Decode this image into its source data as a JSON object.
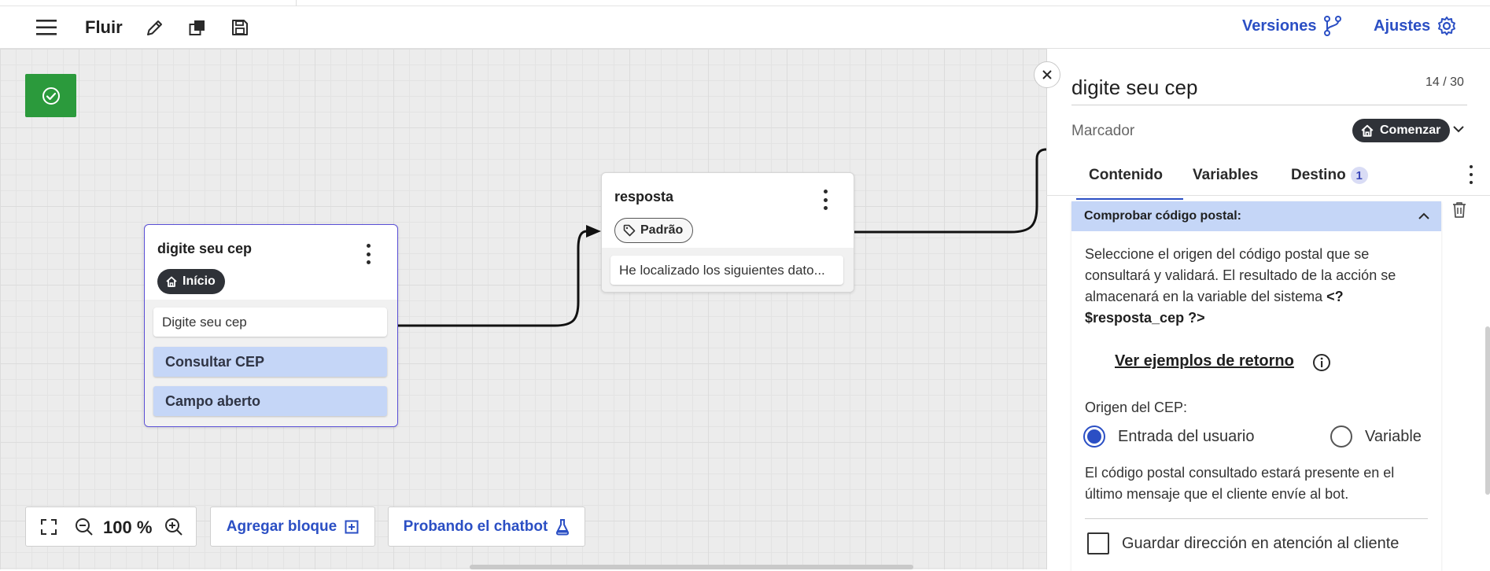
{
  "toolbar": {
    "title": "Fluir",
    "versions_label": "Versiones",
    "settings_label": "Ajustes"
  },
  "canvas": {
    "nodes": [
      {
        "title": "digite seu cep",
        "tag": "Início",
        "message": "Digite seu cep",
        "buttons": [
          "Consultar CEP",
          "Campo aberto"
        ]
      },
      {
        "title": "resposta",
        "tag": "Padrão",
        "message": "He localizado los siguientes dato..."
      }
    ],
    "zoom": "100 %",
    "add_block_label": "Agregar bloque",
    "test_chatbot_label": "Probando el chatbot"
  },
  "panel": {
    "title": "digite seu cep",
    "char_count": "14 / 30",
    "marker_label": "Marcador",
    "marker_value": "Comenzar",
    "tabs": [
      {
        "label": "Contenido",
        "active": true
      },
      {
        "label": "Variables",
        "active": false
      },
      {
        "label": "Destino",
        "badge": "1",
        "active": false
      }
    ],
    "section": {
      "title": "Comprobar código postal:",
      "description": "Seleccione el origen del código postal que se consultará y validará. El resultado de la acción se almacenará en la variable del sistema ",
      "variable": "<?$resposta_cep ?>",
      "examples_link": "Ver ejemplos de retorno",
      "origin_label": "Origen del CEP:",
      "origin_options": [
        {
          "label": "Entrada del usuario",
          "selected": true
        },
        {
          "label": "Variable",
          "selected": false
        }
      ],
      "note": "El código postal consultado estará presente en el último mensaje que el cliente envíe al bot.",
      "save_address_label": "Guardar dirección en atención al cliente"
    }
  },
  "colors": {
    "accent": "#2b4fc4",
    "success": "#2b9a3c",
    "action_button": "#c5d6f7",
    "chip_dark": "#2f3238",
    "node_selected_border": "#5a4fd6"
  }
}
